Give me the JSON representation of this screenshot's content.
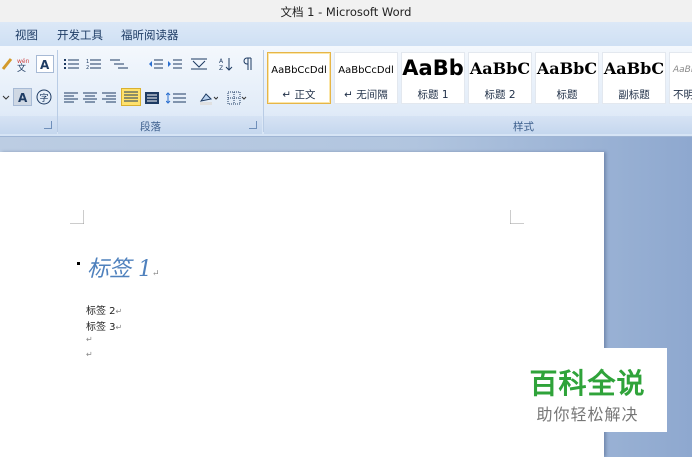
{
  "window": {
    "title": "文档 1 - Microsoft Word"
  },
  "menu": {
    "tabs": [
      "视图",
      "开发工具",
      "福昕阅读器"
    ]
  },
  "ribbon": {
    "groups": {
      "paragraph": "段落",
      "styles": "样式"
    },
    "styles": [
      {
        "sample": "AaBbCcDdl",
        "name": "↵ 正文"
      },
      {
        "sample": "AaBbCcDdl",
        "name": "↵ 无间隔"
      },
      {
        "sample": "AaBb",
        "name": "标题 1"
      },
      {
        "sample": "AaBbC",
        "name": "标题 2"
      },
      {
        "sample": "AaBbC",
        "name": "标题"
      },
      {
        "sample": "AaBbC",
        "name": "副标题"
      },
      {
        "sample": "AaBl",
        "name": "不明"
      }
    ]
  },
  "document": {
    "heading": "标签 1",
    "lines": [
      "标签 2",
      "标签 3"
    ],
    "paragraph_mark": "↵"
  },
  "watermark": {
    "title": "百科全说",
    "subtitle": "助你轻松解决"
  },
  "colors": {
    "ribbon_blue": "#dce8f7",
    "watermark_green": "#2fa33a",
    "heading_blue": "#4f81bd"
  }
}
